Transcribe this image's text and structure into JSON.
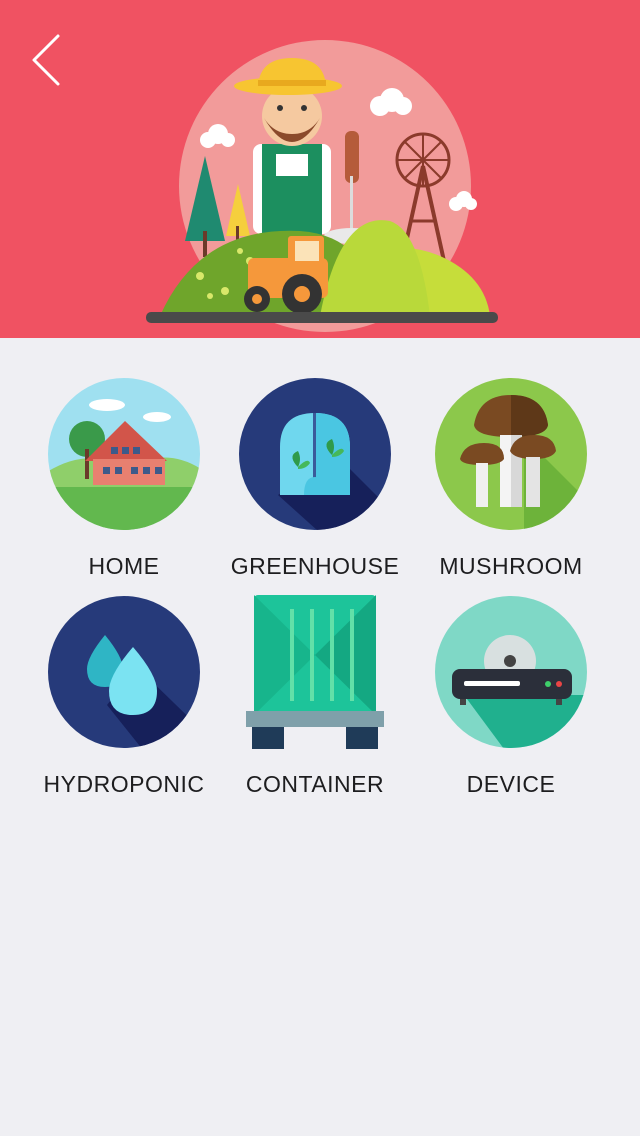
{
  "header": {
    "back_icon": "chevron-left-icon",
    "illustration": "farmer-illustration"
  },
  "categories": [
    {
      "id": "home",
      "label": "HOME",
      "icon": "house-icon"
    },
    {
      "id": "greenhouse",
      "label": "GREENHOUSE",
      "icon": "greenhouse-icon"
    },
    {
      "id": "mushroom",
      "label": "MUSHROOM",
      "icon": "mushroom-icon"
    },
    {
      "id": "hydroponic",
      "label": "HYDROPONIC",
      "icon": "water-drops-icon"
    },
    {
      "id": "container",
      "label": "CONTAINER",
      "icon": "container-icon"
    },
    {
      "id": "device",
      "label": "DEVICE",
      "icon": "device-icon"
    }
  ],
  "colors": {
    "header_bg": "#f05262",
    "page_bg": "#efeff3",
    "label_text": "#1d1d1f"
  }
}
